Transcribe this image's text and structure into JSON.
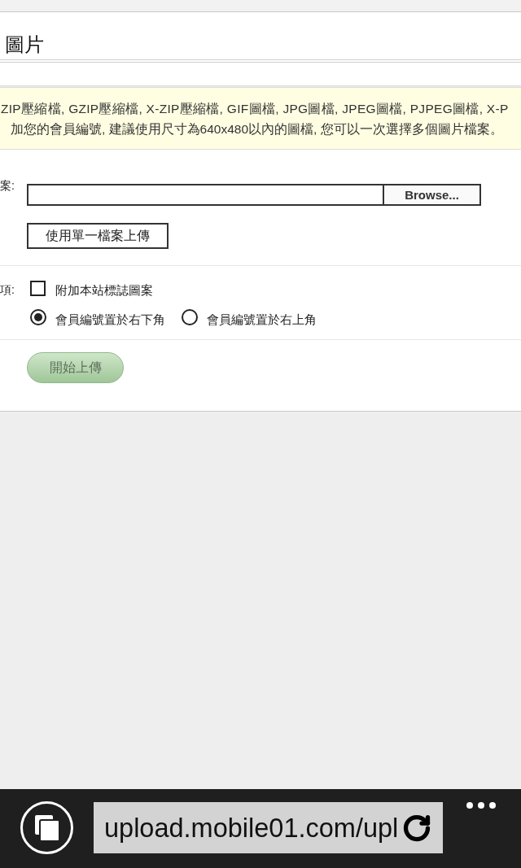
{
  "page_title": "圖片",
  "notice": {
    "lines": [
      "ZIP壓縮檔, GZIP壓縮檔, X-ZIP壓縮檔, GIF圖檔, JPG圖檔, JPEG圖檔, PJPEG圖檔, X-P",
      "加您的會員編號, 建議使用尺寸為640x480以內的圖檔, 您可以一次選擇多個圖片檔案。"
    ]
  },
  "form": {
    "file_label": "案:",
    "browse_button": "Browse...",
    "single_upload_button": "使用單一檔案上傳",
    "options_label": "項:",
    "options": [
      {
        "kind": "checkbox",
        "label": "附加本站標誌圖案",
        "checked": false
      }
    ],
    "position_radios": [
      {
        "label": "會員編號置於右下角",
        "selected": true
      },
      {
        "label": "會員編號置於右上角",
        "selected": false
      }
    ],
    "submit_button": "開始上傳"
  },
  "browser_bar": {
    "address": "upload.mobile01.com/upl"
  }
}
